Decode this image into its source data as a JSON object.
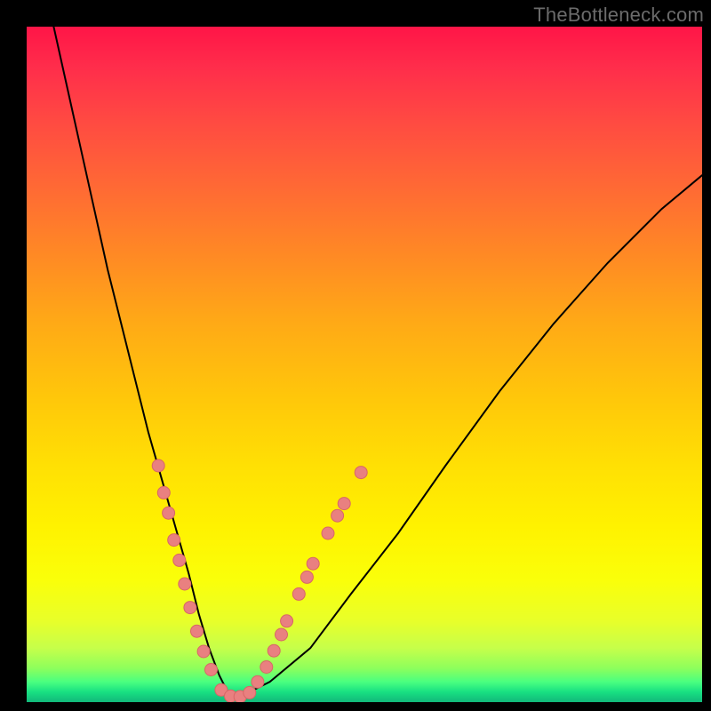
{
  "watermark": "TheBottleneck.com",
  "chart_data": {
    "type": "line",
    "title": "",
    "xlabel": "",
    "ylabel": "",
    "xlim": [
      0,
      100
    ],
    "ylim": [
      0,
      100
    ],
    "grid": false,
    "background_gradient": {
      "orientation": "vertical",
      "stops": [
        {
          "pos": 0.0,
          "color": "#ff1547"
        },
        {
          "pos": 0.25,
          "color": "#ff6a34"
        },
        {
          "pos": 0.55,
          "color": "#ffc70a"
        },
        {
          "pos": 0.78,
          "color": "#fff200"
        },
        {
          "pos": 0.92,
          "color": "#c6ff4a"
        },
        {
          "pos": 1.0,
          "color": "#12b87a"
        }
      ]
    },
    "series": [
      {
        "name": "bottleneck-curve",
        "x": [
          4,
          6,
          8,
          10,
          12,
          14,
          16,
          18,
          20,
          22,
          24,
          25.5,
          27,
          28.5,
          30,
          32,
          36,
          42,
          48,
          55,
          62,
          70,
          78,
          86,
          94,
          100
        ],
        "y": [
          100,
          91,
          82,
          73,
          64,
          56,
          48,
          40,
          33,
          26,
          19,
          13,
          8,
          4,
          1,
          1,
          3,
          8,
          16,
          25,
          35,
          46,
          56,
          65,
          73,
          78
        ]
      }
    ],
    "points": [
      {
        "name": "marker-cluster-left",
        "x": 19.5,
        "y": 35
      },
      {
        "name": "marker-cluster-left",
        "x": 20.3,
        "y": 31
      },
      {
        "name": "marker-cluster-left",
        "x": 21.0,
        "y": 28
      },
      {
        "name": "marker-cluster-left",
        "x": 21.8,
        "y": 24
      },
      {
        "name": "marker-cluster-left",
        "x": 22.6,
        "y": 21
      },
      {
        "name": "marker-cluster-left",
        "x": 23.4,
        "y": 17.5
      },
      {
        "name": "marker-cluster-left",
        "x": 24.2,
        "y": 14
      },
      {
        "name": "marker-cluster-left",
        "x": 25.2,
        "y": 10.5
      },
      {
        "name": "marker-cluster-left",
        "x": 26.2,
        "y": 7.5
      },
      {
        "name": "marker-cluster-left",
        "x": 27.3,
        "y": 4.8
      },
      {
        "name": "marker-cluster-bottom",
        "x": 28.8,
        "y": 1.8
      },
      {
        "name": "marker-cluster-bottom",
        "x": 30.2,
        "y": 0.9
      },
      {
        "name": "marker-cluster-bottom",
        "x": 31.6,
        "y": 0.8
      },
      {
        "name": "marker-cluster-bottom",
        "x": 33.0,
        "y": 1.4
      },
      {
        "name": "marker-cluster-right",
        "x": 34.2,
        "y": 3.0
      },
      {
        "name": "marker-cluster-right",
        "x": 35.5,
        "y": 5.2
      },
      {
        "name": "marker-cluster-right",
        "x": 36.6,
        "y": 7.6
      },
      {
        "name": "marker-cluster-right",
        "x": 37.7,
        "y": 10.0
      },
      {
        "name": "marker-cluster-right",
        "x": 38.5,
        "y": 12.0
      },
      {
        "name": "marker-cluster-right",
        "x": 40.3,
        "y": 16.0
      },
      {
        "name": "marker-cluster-right",
        "x": 41.5,
        "y": 18.5
      },
      {
        "name": "marker-cluster-right",
        "x": 42.4,
        "y": 20.5
      },
      {
        "name": "marker-cluster-right",
        "x": 44.6,
        "y": 25.0
      },
      {
        "name": "marker-cluster-right",
        "x": 46.0,
        "y": 27.6
      },
      {
        "name": "marker-cluster-right",
        "x": 47.0,
        "y": 29.4
      },
      {
        "name": "marker-cluster-right",
        "x": 49.5,
        "y": 34.0
      }
    ],
    "marker_color": "#e98080",
    "marker_radius_px": 7
  }
}
